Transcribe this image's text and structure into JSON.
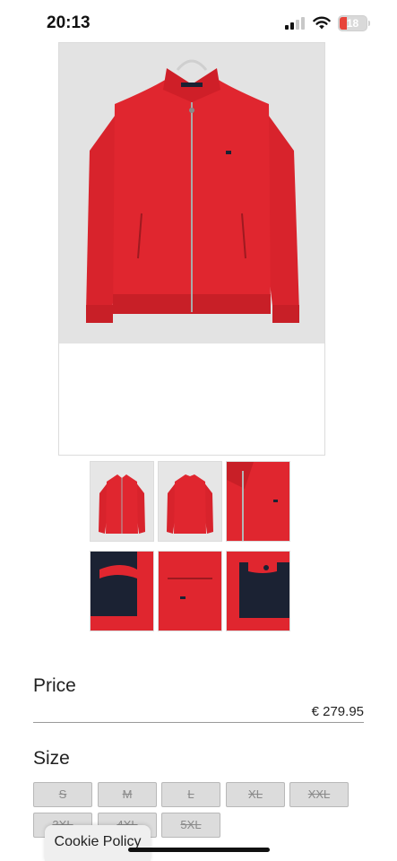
{
  "status_bar": {
    "time": "20:13",
    "battery_level": "18",
    "battery_color": "#e8443a"
  },
  "product": {
    "main_image": {
      "alt_icon": "red-jacket-front-image"
    },
    "thumbnails": [
      {
        "icon": "jacket-front-thumbnail"
      },
      {
        "icon": "jacket-back-thumbnail"
      },
      {
        "icon": "jacket-collar-closeup-thumbnail"
      },
      {
        "icon": "jacket-inside-lining-thumbnail"
      },
      {
        "icon": "jacket-pocket-closeup-thumbnail"
      },
      {
        "icon": "jacket-inner-pocket-thumbnail"
      }
    ],
    "price_label": "Price",
    "price_value": "€ 279.95",
    "size_label": "Size",
    "sizes": [
      "S",
      "M",
      "L",
      "XL",
      "XXL",
      "3XL",
      "4XL",
      "5XL"
    ]
  },
  "cookie_policy": "Cookie Policy",
  "colors": {
    "jacket_red": "#e0262f",
    "lining_navy": "#1b2233",
    "unavailable_grey": "#dcdcdc"
  }
}
